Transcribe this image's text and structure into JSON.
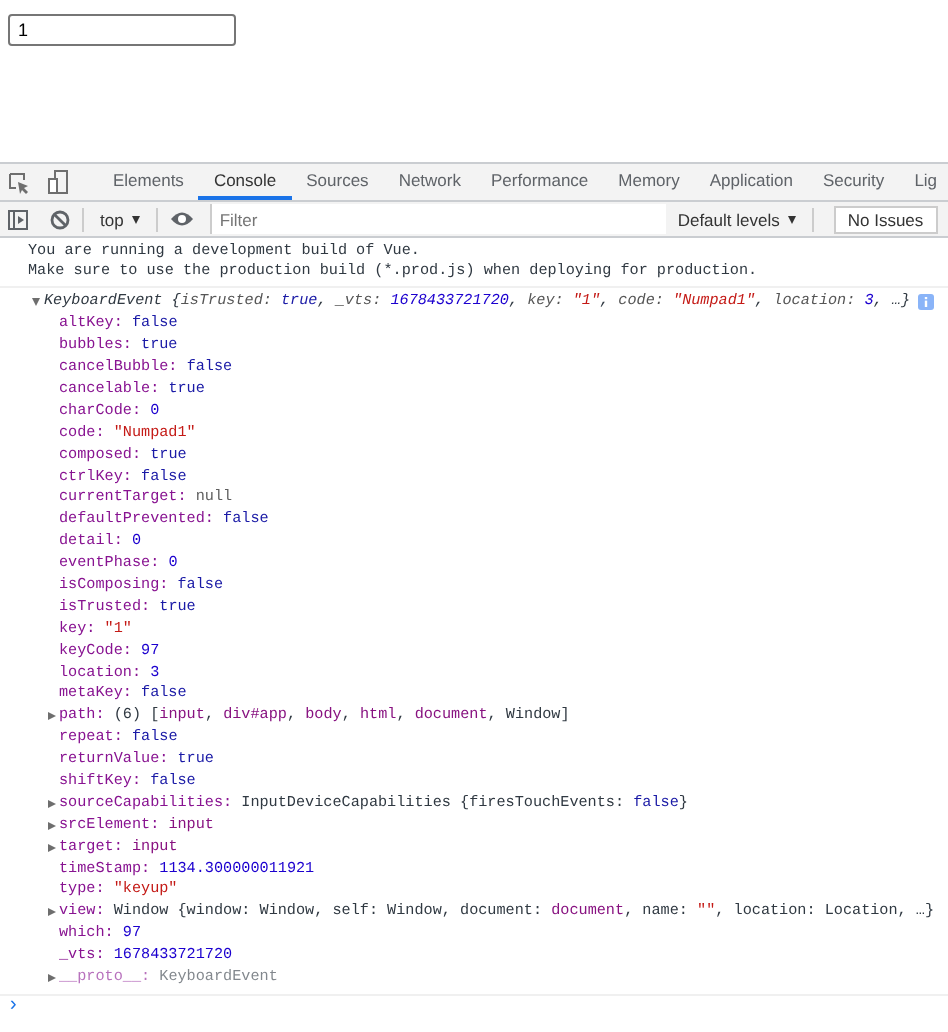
{
  "page": {
    "input": {
      "value": "1"
    }
  },
  "devtools": {
    "tabs": [
      {
        "label": "Elements",
        "selected": false
      },
      {
        "label": "Console",
        "selected": true
      },
      {
        "label": "Sources",
        "selected": false
      },
      {
        "label": "Network",
        "selected": false
      },
      {
        "label": "Performance",
        "selected": false
      },
      {
        "label": "Memory",
        "selected": false
      },
      {
        "label": "Application",
        "selected": false
      },
      {
        "label": "Security",
        "selected": false
      },
      {
        "label": "Lig",
        "selected": false
      }
    ],
    "toolbar": {
      "context": "top",
      "filter": {
        "placeholder": "Filter"
      },
      "levels": "Default levels",
      "issues": "No Issues"
    },
    "console": {
      "messages": [
        "You are running a development build of Vue.",
        "Make sure to use the production build (*.prod.js) when deploying for production."
      ],
      "object": {
        "expanded": true,
        "summary": [
          {
            "text": "KeyboardEvent {",
            "kind": "plain"
          },
          {
            "text": "isTrusted: ",
            "kind": "label"
          },
          {
            "text": "true",
            "kind": "keyword"
          },
          {
            "text": ", ",
            "kind": "plain"
          },
          {
            "text": "_vts: ",
            "kind": "label"
          },
          {
            "text": "1678433721720",
            "kind": "number"
          },
          {
            "text": ", ",
            "kind": "plain"
          },
          {
            "text": "key: ",
            "kind": "label"
          },
          {
            "text": "\"1\"",
            "kind": "string"
          },
          {
            "text": ", ",
            "kind": "plain"
          },
          {
            "text": "code: ",
            "kind": "label"
          },
          {
            "text": "\"Numpad1\"",
            "kind": "string"
          },
          {
            "text": ", ",
            "kind": "plain"
          },
          {
            "text": "location: ",
            "kind": "label"
          },
          {
            "text": "3",
            "kind": "number"
          },
          {
            "text": ", …}",
            "kind": "plain"
          }
        ],
        "properties": [
          {
            "expandable": false,
            "dimmed": false,
            "parts": [
              {
                "text": "altKey: ",
                "kind": "key"
              },
              {
                "text": "false",
                "kind": "keyword"
              }
            ]
          },
          {
            "expandable": false,
            "dimmed": false,
            "parts": [
              {
                "text": "bubbles: ",
                "kind": "key"
              },
              {
                "text": "true",
                "kind": "keyword"
              }
            ]
          },
          {
            "expandable": false,
            "dimmed": false,
            "parts": [
              {
                "text": "cancelBubble: ",
                "kind": "key"
              },
              {
                "text": "false",
                "kind": "keyword"
              }
            ]
          },
          {
            "expandable": false,
            "dimmed": false,
            "parts": [
              {
                "text": "cancelable: ",
                "kind": "key"
              },
              {
                "text": "true",
                "kind": "keyword"
              }
            ]
          },
          {
            "expandable": false,
            "dimmed": false,
            "parts": [
              {
                "text": "charCode: ",
                "kind": "key"
              },
              {
                "text": "0",
                "kind": "number"
              }
            ]
          },
          {
            "expandable": false,
            "dimmed": false,
            "parts": [
              {
                "text": "code: ",
                "kind": "key"
              },
              {
                "text": "\"Numpad1\"",
                "kind": "string"
              }
            ]
          },
          {
            "expandable": false,
            "dimmed": false,
            "parts": [
              {
                "text": "composed: ",
                "kind": "key"
              },
              {
                "text": "true",
                "kind": "keyword"
              }
            ]
          },
          {
            "expandable": false,
            "dimmed": false,
            "parts": [
              {
                "text": "ctrlKey: ",
                "kind": "key"
              },
              {
                "text": "false",
                "kind": "keyword"
              }
            ]
          },
          {
            "expandable": false,
            "dimmed": false,
            "parts": [
              {
                "text": "currentTarget: ",
                "kind": "key"
              },
              {
                "text": "null",
                "kind": "null"
              }
            ]
          },
          {
            "expandable": false,
            "dimmed": false,
            "parts": [
              {
                "text": "defaultPrevented: ",
                "kind": "key"
              },
              {
                "text": "false",
                "kind": "keyword"
              }
            ]
          },
          {
            "expandable": false,
            "dimmed": false,
            "parts": [
              {
                "text": "detail: ",
                "kind": "key"
              },
              {
                "text": "0",
                "kind": "number"
              }
            ]
          },
          {
            "expandable": false,
            "dimmed": false,
            "parts": [
              {
                "text": "eventPhase: ",
                "kind": "key"
              },
              {
                "text": "0",
                "kind": "number"
              }
            ]
          },
          {
            "expandable": false,
            "dimmed": false,
            "parts": [
              {
                "text": "isComposing: ",
                "kind": "key"
              },
              {
                "text": "false",
                "kind": "keyword"
              }
            ]
          },
          {
            "expandable": false,
            "dimmed": false,
            "parts": [
              {
                "text": "isTrusted: ",
                "kind": "key"
              },
              {
                "text": "true",
                "kind": "keyword"
              }
            ]
          },
          {
            "expandable": false,
            "dimmed": false,
            "parts": [
              {
                "text": "key: ",
                "kind": "key"
              },
              {
                "text": "\"1\"",
                "kind": "string"
              }
            ]
          },
          {
            "expandable": false,
            "dimmed": false,
            "parts": [
              {
                "text": "keyCode: ",
                "kind": "key"
              },
              {
                "text": "97",
                "kind": "number"
              }
            ]
          },
          {
            "expandable": false,
            "dimmed": false,
            "parts": [
              {
                "text": "location: ",
                "kind": "key"
              },
              {
                "text": "3",
                "kind": "number"
              }
            ]
          },
          {
            "expandable": false,
            "dimmed": false,
            "parts": [
              {
                "text": "metaKey: ",
                "kind": "key"
              },
              {
                "text": "false",
                "kind": "keyword"
              }
            ]
          },
          {
            "expandable": true,
            "dimmed": false,
            "parts": [
              {
                "text": "path: ",
                "kind": "key"
              },
              {
                "text": "(6) [",
                "kind": "plain"
              },
              {
                "text": "input",
                "kind": "node"
              },
              {
                "text": ", ",
                "kind": "plain"
              },
              {
                "text": "div#app",
                "kind": "node"
              },
              {
                "text": ", ",
                "kind": "plain"
              },
              {
                "text": "body",
                "kind": "node"
              },
              {
                "text": ", ",
                "kind": "plain"
              },
              {
                "text": "html",
                "kind": "node"
              },
              {
                "text": ", ",
                "kind": "plain"
              },
              {
                "text": "document",
                "kind": "node"
              },
              {
                "text": ", Window]",
                "kind": "plain"
              }
            ]
          },
          {
            "expandable": false,
            "dimmed": false,
            "parts": [
              {
                "text": "repeat: ",
                "kind": "key"
              },
              {
                "text": "false",
                "kind": "keyword"
              }
            ]
          },
          {
            "expandable": false,
            "dimmed": false,
            "parts": [
              {
                "text": "returnValue: ",
                "kind": "key"
              },
              {
                "text": "true",
                "kind": "keyword"
              }
            ]
          },
          {
            "expandable": false,
            "dimmed": false,
            "parts": [
              {
                "text": "shiftKey: ",
                "kind": "key"
              },
              {
                "text": "false",
                "kind": "keyword"
              }
            ]
          },
          {
            "expandable": true,
            "dimmed": false,
            "parts": [
              {
                "text": "sourceCapabilities: ",
                "kind": "key"
              },
              {
                "text": "InputDeviceCapabilities {firesTouchEvents: ",
                "kind": "plain"
              },
              {
                "text": "false",
                "kind": "keyword"
              },
              {
                "text": "}",
                "kind": "plain"
              }
            ]
          },
          {
            "expandable": true,
            "dimmed": false,
            "parts": [
              {
                "text": "srcElement: ",
                "kind": "key"
              },
              {
                "text": "input",
                "kind": "node"
              }
            ]
          },
          {
            "expandable": true,
            "dimmed": false,
            "parts": [
              {
                "text": "target: ",
                "kind": "key"
              },
              {
                "text": "input",
                "kind": "node"
              }
            ]
          },
          {
            "expandable": false,
            "dimmed": false,
            "parts": [
              {
                "text": "timeStamp: ",
                "kind": "key"
              },
              {
                "text": "1134.300000011921",
                "kind": "number"
              }
            ]
          },
          {
            "expandable": false,
            "dimmed": false,
            "parts": [
              {
                "text": "type: ",
                "kind": "key"
              },
              {
                "text": "\"keyup\"",
                "kind": "string"
              }
            ]
          },
          {
            "expandable": true,
            "dimmed": false,
            "parts": [
              {
                "text": "view: ",
                "kind": "key"
              },
              {
                "text": "Window {window: Window, self: Window, document: ",
                "kind": "plain"
              },
              {
                "text": "document",
                "kind": "node"
              },
              {
                "text": ", name: ",
                "kind": "plain"
              },
              {
                "text": "\"\"",
                "kind": "string"
              },
              {
                "text": ", location: Location, …}",
                "kind": "plain"
              }
            ]
          },
          {
            "expandable": false,
            "dimmed": false,
            "parts": [
              {
                "text": "which: ",
                "kind": "key"
              },
              {
                "text": "97",
                "kind": "number"
              }
            ]
          },
          {
            "expandable": false,
            "dimmed": false,
            "parts": [
              {
                "text": "_vts: ",
                "kind": "key"
              },
              {
                "text": "1678433721720",
                "kind": "number"
              }
            ]
          },
          {
            "expandable": true,
            "dimmed": true,
            "parts": [
              {
                "text": "__proto__: ",
                "kind": "key"
              },
              {
                "text": "KeyboardEvent",
                "kind": "plain"
              }
            ]
          }
        ],
        "prompt": "›"
      }
    }
  }
}
